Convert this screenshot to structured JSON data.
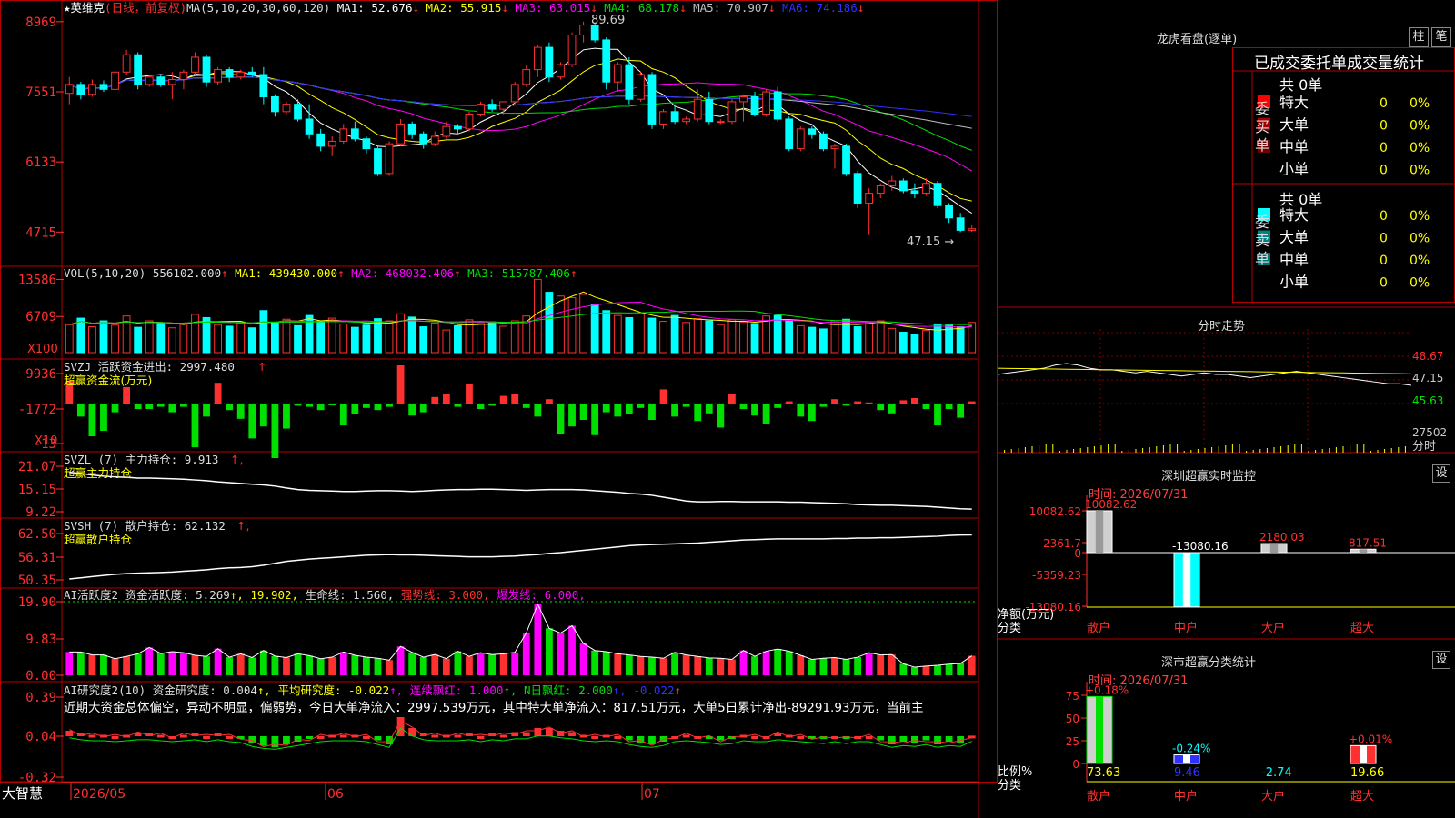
{
  "colors": {
    "up": "#ff3030",
    "down": "#00ffff",
    "bg": "#000000",
    "frame": "#b40000",
    "white": "#ffffff",
    "yellow": "#ffff00",
    "magenta": "#ff00ff",
    "green": "#00e000",
    "blue": "#3030ff",
    "grid": "#800000",
    "text": "#dcdcdc"
  },
  "header": {
    "star": "★",
    "name": "英维克",
    "period": "(日线，前复权)",
    "ma_params": "MA(5,10,20,30,60,120)",
    "ma": [
      {
        "label": "MA1:",
        "value": "52.676",
        "arrow": "↓",
        "color": "#ffffff"
      },
      {
        "label": "MA2:",
        "value": "55.915",
        "arrow": "↓",
        "color": "#ffff00"
      },
      {
        "label": "MA3:",
        "value": "63.015",
        "arrow": "↓",
        "color": "#ff00ff"
      },
      {
        "label": "MA4:",
        "value": "68.178",
        "arrow": "↓",
        "color": "#00e000"
      },
      {
        "label": "MA5:",
        "value": "70.907",
        "arrow": "↓",
        "color": "#c0c0c0"
      },
      {
        "label": "MA6:",
        "value": "74.186",
        "arrow": "↓",
        "color": "#3030ff"
      }
    ]
  },
  "vol_header": {
    "label": "VOL(5,10,20)",
    "value": "556102.000",
    "arrow": "↑",
    "ma": [
      {
        "label": "MA1:",
        "value": "439430.000",
        "arrow": "↑",
        "color": "#ffff00"
      },
      {
        "label": "MA2:",
        "value": "468032.406",
        "arrow": "↑",
        "color": "#ff00ff"
      },
      {
        "label": "MA3:",
        "value": "515787.406",
        "arrow": "↑",
        "color": "#00e000"
      }
    ]
  },
  "svzj": {
    "line1": "SVZJ  活跃资金进出: 2997.480",
    "arrow": "↑",
    "line2": "超赢资金流(万元)"
  },
  "svzl": {
    "line1": "SVZL (7) 主力持仓: 9.913",
    "arrow": "↑,",
    "line2": "超赢主力持仓"
  },
  "svsh": {
    "line1": "SVSH (7) 散户持仓: 62.132",
    "arrow": "↑,",
    "line2": "超赢散户持仓"
  },
  "ai1": {
    "parts": [
      {
        "t": "AI活跃度2 资金活跃度: 5.269",
        "c": "#dcdcdc"
      },
      {
        "t": "↑, 19.902,",
        "c": "#ffff00"
      },
      {
        "t": " 生命线: 1.560,",
        "c": "#dcdcdc"
      },
      {
        "t": " 强势线: 3.000,",
        "c": "#ff3030"
      },
      {
        "t": " 爆发线: 6.000,",
        "c": "#ff00ff"
      }
    ]
  },
  "ai2": {
    "parts": [
      {
        "t": "AI研究度2(10) 资金研究度: 0.004",
        "c": "#dcdcdc"
      },
      {
        "t": "↑, 平均研究度: -0.022",
        "c": "#ffff00"
      },
      {
        "t": "↑, 连续飘红: 1.000",
        "c": "#ff00ff"
      },
      {
        "t": "↑, N日飘红: 2.000",
        "c": "#00e000"
      },
      {
        "t": "↑, -0.022",
        "c": "#3030ff"
      },
      {
        "t": "↑",
        "c": "#ff3030"
      }
    ],
    "text": "近期大资金总体偏空，异动不明显，偏弱势，今日大单净流入：2997.539万元，其中特大单净流入：817.51万元，大单5日累计净出-89291.93万元，当前主"
  },
  "annotations": {
    "high": "89.69",
    "low": "47.15"
  },
  "panel_scales": {
    "price": {
      "ticks": [
        "8969",
        "7551",
        "6133",
        "4715"
      ]
    },
    "vol": {
      "ticks": [
        "13586",
        "6709"
      ],
      "unit": "X100"
    },
    "svzj": {
      "ticks": [
        "9936",
        "-1772",
        "-13"
      ],
      "unit": "X10"
    },
    "svzl": {
      "ticks": [
        "21.07",
        "15.15",
        "9.22"
      ]
    },
    "svsh": {
      "ticks": [
        "62.50",
        "56.31",
        "50.35"
      ]
    },
    "ai1": {
      "ticks": [
        "19.90",
        "9.83",
        "0.00"
      ]
    },
    "ai2": {
      "ticks": [
        "0.39",
        "0.04",
        "-0.32"
      ]
    }
  },
  "x_axis": {
    "brand": "大智慧",
    "labels": [
      "2026/05",
      "06",
      "07"
    ]
  },
  "chart_data": {
    "type": "candlestick",
    "ohlc": [
      [
        75.2,
        78.5,
        73.0,
        77.0
      ],
      [
        77.0,
        77.5,
        74.0,
        75.0
      ],
      [
        75.0,
        78.0,
        74.5,
        77.0
      ],
      [
        77.0,
        77.8,
        75.5,
        76.0
      ],
      [
        76.0,
        80.5,
        75.5,
        79.5
      ],
      [
        79.5,
        84.0,
        79.0,
        83.0
      ],
      [
        83.0,
        83.5,
        76.0,
        77.0
      ],
      [
        77.0,
        79.0,
        76.5,
        78.5
      ],
      [
        78.5,
        79.0,
        76.5,
        77.0
      ],
      [
        77.0,
        79.5,
        74.0,
        78.0
      ],
      [
        78.0,
        80.0,
        76.0,
        79.5
      ],
      [
        79.5,
        83.5,
        79.0,
        82.5
      ],
      [
        82.5,
        83.0,
        76.5,
        77.5
      ],
      [
        77.5,
        80.5,
        77.0,
        80.0
      ],
      [
        80.0,
        80.5,
        77.5,
        78.5
      ],
      [
        78.5,
        80.0,
        78.0,
        79.5
      ],
      [
        79.5,
        80.5,
        78.5,
        79.0
      ],
      [
        79.0,
        80.5,
        73.0,
        74.5
      ],
      [
        74.5,
        75.0,
        70.5,
        71.5
      ],
      [
        71.5,
        73.5,
        71.0,
        73.0
      ],
      [
        73.0,
        74.0,
        69.5,
        70.0
      ],
      [
        70.0,
        73.0,
        66.0,
        67.0
      ],
      [
        67.0,
        68.0,
        63.5,
        64.5
      ],
      [
        64.5,
        66.5,
        62.5,
        65.5
      ],
      [
        65.5,
        69.0,
        65.0,
        68.0
      ],
      [
        68.0,
        69.5,
        65.5,
        66.0
      ],
      [
        66.0,
        66.5,
        63.0,
        64.0
      ],
      [
        64.0,
        64.5,
        58.5,
        59.0
      ],
      [
        59.0,
        65.5,
        58.5,
        65.0
      ],
      [
        65.0,
        70.0,
        64.5,
        69.0
      ],
      [
        69.0,
        69.5,
        66.0,
        67.0
      ],
      [
        67.0,
        67.5,
        64.0,
        65.0
      ],
      [
        65.0,
        67.5,
        64.5,
        66.5
      ],
      [
        66.5,
        69.5,
        66.0,
        68.5
      ],
      [
        68.5,
        69.0,
        67.0,
        68.0
      ],
      [
        68.0,
        71.5,
        67.5,
        71.0
      ],
      [
        71.0,
        73.5,
        70.5,
        73.0
      ],
      [
        73.0,
        74.0,
        71.5,
        72.0
      ],
      [
        72.0,
        73.5,
        71.0,
        73.5
      ],
      [
        73.5,
        77.5,
        73.0,
        77.0
      ],
      [
        77.0,
        81.0,
        76.5,
        80.0
      ],
      [
        80.0,
        85.0,
        78.5,
        84.5
      ],
      [
        84.5,
        85.5,
        77.5,
        78.5
      ],
      [
        78.5,
        81.5,
        78.0,
        81.0
      ],
      [
        81.0,
        87.5,
        80.5,
        87.0
      ],
      [
        87.0,
        89.69,
        85.5,
        89.0
      ],
      [
        89.0,
        89.5,
        85.5,
        86.0
      ],
      [
        86.0,
        86.5,
        76.0,
        77.5
      ],
      [
        77.5,
        81.5,
        75.5,
        81.0
      ],
      [
        81.0,
        82.5,
        73.0,
        74.0
      ],
      [
        74.0,
        79.5,
        73.5,
        79.0
      ],
      [
        79.0,
        79.5,
        68.0,
        69.0
      ],
      [
        69.0,
        72.0,
        68.0,
        71.5
      ],
      [
        71.5,
        73.0,
        69.0,
        69.5
      ],
      [
        69.5,
        70.5,
        69.0,
        70.0
      ],
      [
        70.0,
        76.0,
        69.5,
        74.0
      ],
      [
        74.0,
        75.5,
        69.0,
        69.5
      ],
      [
        69.5,
        70.0,
        69.0,
        69.5
      ],
      [
        69.5,
        74.0,
        69.0,
        73.5
      ],
      [
        73.5,
        75.0,
        69.5,
        74.5
      ],
      [
        74.5,
        75.5,
        70.5,
        71.0
      ],
      [
        71.0,
        76.0,
        70.5,
        75.5
      ],
      [
        75.5,
        76.5,
        69.5,
        70.0
      ],
      [
        70.0,
        70.5,
        63.5,
        64.0
      ],
      [
        64.0,
        68.5,
        63.5,
        68.0
      ],
      [
        68.0,
        68.5,
        66.0,
        67.0
      ],
      [
        67.0,
        67.5,
        63.5,
        64.0
      ],
      [
        64.0,
        65.0,
        60.0,
        64.5
      ],
      [
        64.5,
        65.0,
        58.5,
        59.0
      ],
      [
        59.0,
        59.5,
        52.0,
        53.0
      ],
      [
        53.0,
        56.0,
        46.5,
        55.0
      ],
      [
        55.0,
        57.0,
        54.0,
        56.5
      ],
      [
        56.5,
        58.5,
        55.5,
        57.5
      ],
      [
        57.5,
        58.0,
        55.0,
        55.5
      ],
      [
        55.5,
        57.0,
        54.0,
        55.0
      ],
      [
        55.0,
        58.0,
        54.5,
        57.0
      ],
      [
        57.0,
        57.5,
        52.0,
        52.5
      ],
      [
        52.5,
        53.0,
        49.0,
        50.0
      ],
      [
        50.0,
        51.0,
        47.15,
        47.5
      ],
      [
        47.5,
        48.5,
        47.15,
        47.8
      ]
    ],
    "volume": [
      5.2,
      6.4,
      4.8,
      5.9,
      5.1,
      6.8,
      4.7,
      5.9,
      5.5,
      4.6,
      5.3,
      7.1,
      6.5,
      5.2,
      4.9,
      5.4,
      4.6,
      7.8,
      5.6,
      6.2,
      5.0,
      6.9,
      5.8,
      6.4,
      5.3,
      4.7,
      5.1,
      6.3,
      5.9,
      7.2,
      6.6,
      4.8,
      5.5,
      4.2,
      5.0,
      6.1,
      5.4,
      5.7,
      4.9,
      5.9,
      6.8,
      13.6,
      11.2,
      10.5,
      10.2,
      10.8,
      8.9,
      7.8,
      6.9,
      6.5,
      7.2,
      6.4,
      5.8,
      6.9,
      5.6,
      6.3,
      5.9,
      5.2,
      6.1,
      5.7,
      5.4,
      6.8,
      6.9,
      5.9,
      5.0,
      4.7,
      4.4,
      5.9,
      6.2,
      4.8,
      5.6,
      5.9,
      4.5,
      3.8,
      3.4,
      4.1,
      5.2,
      5.1,
      4.8,
      5.6
    ],
    "svzj": [
      2.1,
      -1.2,
      -3.0,
      -2.5,
      -0.8,
      1.5,
      -0.5,
      -0.5,
      -0.3,
      -0.8,
      -0.3,
      -4.0,
      -1.2,
      1.9,
      -0.6,
      -1.4,
      -3.2,
      -2.1,
      -5.0,
      -2.3,
      -0.2,
      -0.3,
      -0.6,
      -0.1,
      -2.0,
      -1.0,
      -0.4,
      -0.6,
      -0.3,
      3.5,
      -1.1,
      -0.8,
      0.6,
      0.9,
      -0.3,
      1.8,
      -0.5,
      -0.2,
      0.7,
      0.9,
      -0.4,
      -1.2,
      0.4,
      -2.8,
      -2.1,
      -1.5,
      -2.9,
      -0.8,
      -1.2,
      -1.0,
      -0.4,
      -1.5,
      1.3,
      -1.2,
      -0.3,
      -1.6,
      -0.9,
      -2.2,
      0.9,
      -0.5,
      -1.1,
      -1.9,
      -0.4,
      0.2,
      -1.2,
      -1.6,
      -0.3,
      0.4,
      -0.2,
      0.2,
      0.1,
      -0.6,
      -0.9,
      0.3,
      0.5,
      -0.5,
      -2.0,
      -0.5,
      -1.3,
      0.2
    ],
    "svzl": [
      19.5,
      19.2,
      18.8,
      18.5,
      18.3,
      18.2,
      18.0,
      18.0,
      17.9,
      17.8,
      17.7,
      17.5,
      17.3,
      17.0,
      16.8,
      16.6,
      16.4,
      16.2,
      15.9,
      15.4,
      15.0,
      14.8,
      14.7,
      14.6,
      14.5,
      14.5,
      14.6,
      14.7,
      14.7,
      14.6,
      14.5,
      14.6,
      14.8,
      14.9,
      15.0,
      15.0,
      15.1,
      15.1,
      15.0,
      14.9,
      14.8,
      14.9,
      15.0,
      15.0,
      15.0,
      14.9,
      14.7,
      14.5,
      14.3,
      14.0,
      13.8,
      13.5,
      13.0,
      12.5,
      12.0,
      11.8,
      11.8,
      11.9,
      11.9,
      11.8,
      11.8,
      11.8,
      11.8,
      11.7,
      11.7,
      11.6,
      11.5,
      11.4,
      11.3,
      11.1,
      11.0,
      10.9,
      10.9,
      10.8,
      10.7,
      10.6,
      10.4,
      10.2,
      10.0,
      9.913
    ],
    "svsh": [
      50.6,
      50.9,
      51.2,
      51.5,
      51.8,
      52.0,
      52.1,
      52.2,
      52.3,
      52.4,
      52.6,
      52.8,
      53.0,
      53.3,
      53.5,
      53.6,
      53.8,
      54.2,
      54.7,
      55.2,
      55.5,
      55.8,
      56.0,
      56.2,
      56.4,
      56.6,
      56.8,
      56.9,
      57.0,
      56.9,
      56.9,
      56.8,
      56.7,
      56.6,
      56.5,
      56.4,
      56.4,
      56.4,
      56.5,
      56.6,
      56.8,
      57.0,
      57.3,
      57.5,
      57.8,
      58.1,
      58.4,
      58.7,
      59.0,
      59.3,
      59.5,
      59.6,
      59.7,
      59.8,
      59.9,
      60.0,
      60.2,
      60.4,
      60.6,
      60.8,
      60.9,
      61.0,
      61.1,
      61.1,
      61.1,
      61.1,
      61.1,
      61.2,
      61.2,
      61.3,
      61.3,
      61.4,
      61.4,
      61.5,
      61.6,
      61.7,
      61.8,
      62.0,
      62.1,
      62.132
    ],
    "ai_active": [
      6.3,
      6.3,
      5.5,
      5.5,
      4.5,
      5.1,
      5.8,
      7.5,
      5.9,
      6.4,
      6.1,
      5.4,
      5.1,
      7.2,
      4.9,
      5.8,
      4.8,
      6.7,
      5.2,
      4.8,
      5.8,
      5.3,
      4.5,
      4.9,
      6.3,
      5.4,
      4.9,
      4.6,
      4.1,
      7.8,
      6.2,
      4.9,
      5.6,
      4.5,
      6.5,
      5.1,
      6.1,
      5.6,
      5.8,
      6.2,
      11.5,
      19.2,
      12.7,
      11.4,
      13.4,
      8.6,
      6.7,
      6.4,
      5.8,
      5.5,
      5.1,
      4.9,
      4.6,
      6.2,
      5.5,
      5.1,
      4.7,
      4.6,
      4.3,
      6.7,
      5.1,
      6.5,
      7.1,
      6.5,
      5.4,
      4.3,
      4.6,
      4.8,
      4.3,
      4.9,
      6.1,
      5.5,
      5.6,
      3.1,
      2.2,
      2.5,
      2.7,
      3.0,
      3.2,
      5.269
    ],
    "ai_research": [
      0.04,
      0.02,
      0.01,
      0.01,
      0.0,
      0.01,
      0.02,
      0.02,
      0.01,
      0.0,
      0.01,
      0.02,
      0.0,
      0.02,
      0.0,
      -0.01,
      -0.05,
      -0.07,
      -0.08,
      -0.06,
      -0.04,
      -0.02,
      0.0,
      0.01,
      0.01,
      0.01,
      0.0,
      -0.03,
      -0.06,
      0.14,
      0.06,
      0.02,
      0.01,
      0.01,
      0.01,
      0.02,
      0.0,
      0.02,
      0.01,
      0.03,
      0.03,
      0.06,
      0.06,
      0.04,
      0.03,
      0.01,
      0.0,
      0.01,
      0.0,
      -0.03,
      -0.05,
      -0.06,
      -0.04,
      0.0,
      0.01,
      0.0,
      -0.01,
      -0.03,
      -0.02,
      0.01,
      0.0,
      0.0,
      0.02,
      0.01,
      0.0,
      -0.01,
      -0.02,
      0.0,
      -0.02,
      0.0,
      0.0,
      -0.03,
      -0.06,
      -0.04,
      -0.05,
      -0.03,
      -0.06,
      -0.04,
      -0.05,
      0.004
    ]
  },
  "right": {
    "dragon_title": "龙虎看盘(逐单)",
    "btn1": "柱",
    "btn2": "笔",
    "stat_title": "已成交委托单成交量统计",
    "buy": {
      "label": "委买单",
      "total": "共 0单",
      "rows": [
        {
          "name": "特大",
          "v": "0",
          "p": "0%",
          "c": "#ff0000"
        },
        {
          "name": "大单",
          "v": "0",
          "p": "0%",
          "c": "#a00000"
        },
        {
          "name": "中单",
          "v": "0",
          "p": "0%",
          "c": "#700000"
        },
        {
          "name": "小单",
          "v": "0",
          "p": "0%",
          "c": "#000000"
        }
      ]
    },
    "sell": {
      "label": "委卖单",
      "total": "共 0单",
      "rows": [
        {
          "name": "特大",
          "v": "0",
          "p": "0%",
          "c": "#00ffff"
        },
        {
          "name": "大单",
          "v": "0",
          "p": "0%",
          "c": "#008080"
        },
        {
          "name": "中单",
          "v": "0",
          "p": "0%",
          "c": "#007070"
        },
        {
          "name": "小单",
          "v": "0",
          "p": "0%",
          "c": "#000000"
        }
      ]
    },
    "intraday": {
      "title": "分时走势",
      "ticks": [
        "48.67",
        "47.15",
        "45.63",
        "27502"
      ],
      "unit": "分时",
      "price": [
        47.5,
        47.6,
        47.7,
        47.8,
        47.9,
        48.1,
        48.2,
        48.1,
        47.9,
        47.8,
        47.8,
        47.7,
        47.6,
        47.7,
        47.6,
        47.5,
        47.4,
        47.5,
        47.6,
        47.5,
        47.5,
        47.4,
        47.3,
        47.4,
        47.5,
        47.6,
        47.7,
        47.6,
        47.5,
        47.4,
        47.3,
        47.2,
        47.1,
        47.0,
        46.9,
        46.9,
        46.8
      ]
    },
    "monitor": {
      "title": "深圳超赢实时监控",
      "btn": "设",
      "time": "时间: 2026/07/31",
      "ticks": [
        "10082.62",
        "2361.7",
        "0",
        "-5359.23",
        "-13080.16"
      ],
      "ylabel": "净额(万元)",
      "xlabel": "分类",
      "bars": [
        {
          "name": "散户",
          "value": 10082.62,
          "label": "10082.62"
        },
        {
          "name": "中户",
          "value": -13080.16,
          "label": "-13080.16"
        },
        {
          "name": "大户",
          "value": 2180.03,
          "label": "2180.03"
        },
        {
          "name": "超大",
          "value": 817.51,
          "label": "817.51"
        }
      ]
    },
    "classify": {
      "title": "深市超赢分类统计",
      "btn": "设",
      "time": "时间: 2026/07/31",
      "ticks": [
        "75",
        "50",
        "25",
        "0"
      ],
      "ylabel": "比例%",
      "xlabel": "分类",
      "bars": [
        {
          "name": "散户",
          "value": 73.63,
          "change": "+0.18%"
        },
        {
          "name": "中户",
          "value": 9.46,
          "change": "-0.24%"
        },
        {
          "name": "大户",
          "value": -2.74,
          "change": ""
        },
        {
          "name": "超大",
          "value": 19.66,
          "change": "+0.01%"
        }
      ]
    }
  }
}
